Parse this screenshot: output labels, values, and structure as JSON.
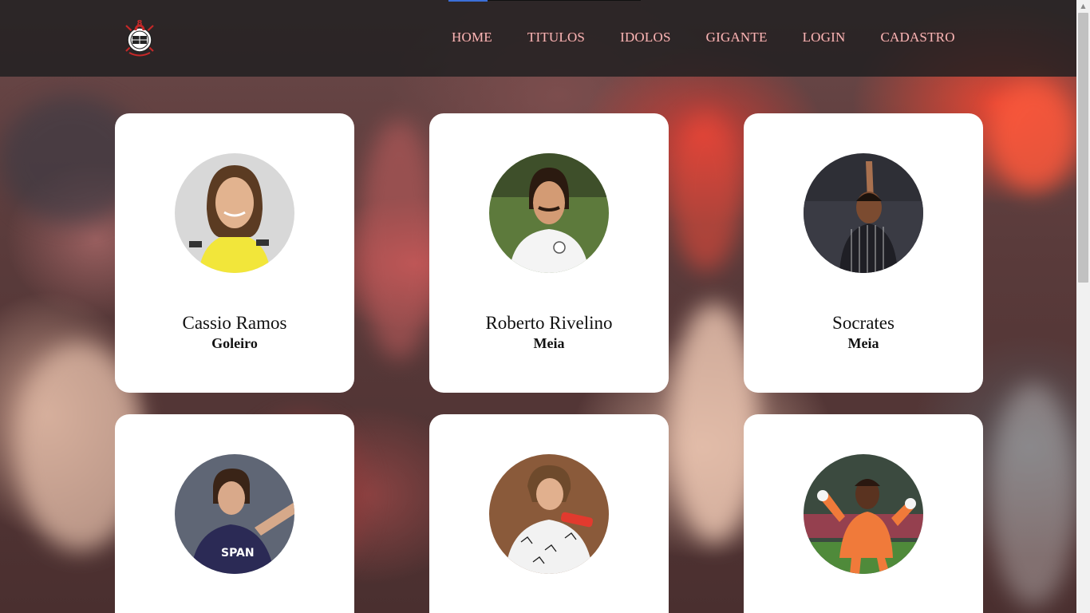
{
  "brand": {
    "logo_name": "corinthians-crest"
  },
  "nav": {
    "items": [
      "HOME",
      "TITULOS",
      "IDOLOS",
      "GIGANTE",
      "LOGIN",
      "CADASTRO"
    ]
  },
  "colors": {
    "nav_text": "#f3b7b7",
    "header_bg": "#1e1e20",
    "card_bg": "#ffffff",
    "active_indicator": "#3b6fd8"
  },
  "cards": [
    {
      "name": "Cassio Ramos",
      "role": "Goleiro"
    },
    {
      "name": "Roberto Rivelino",
      "role": "Meia"
    },
    {
      "name": "Socrates",
      "role": "Meia"
    },
    {
      "name": "",
      "role": ""
    },
    {
      "name": "",
      "role": ""
    },
    {
      "name": "",
      "role": ""
    }
  ]
}
